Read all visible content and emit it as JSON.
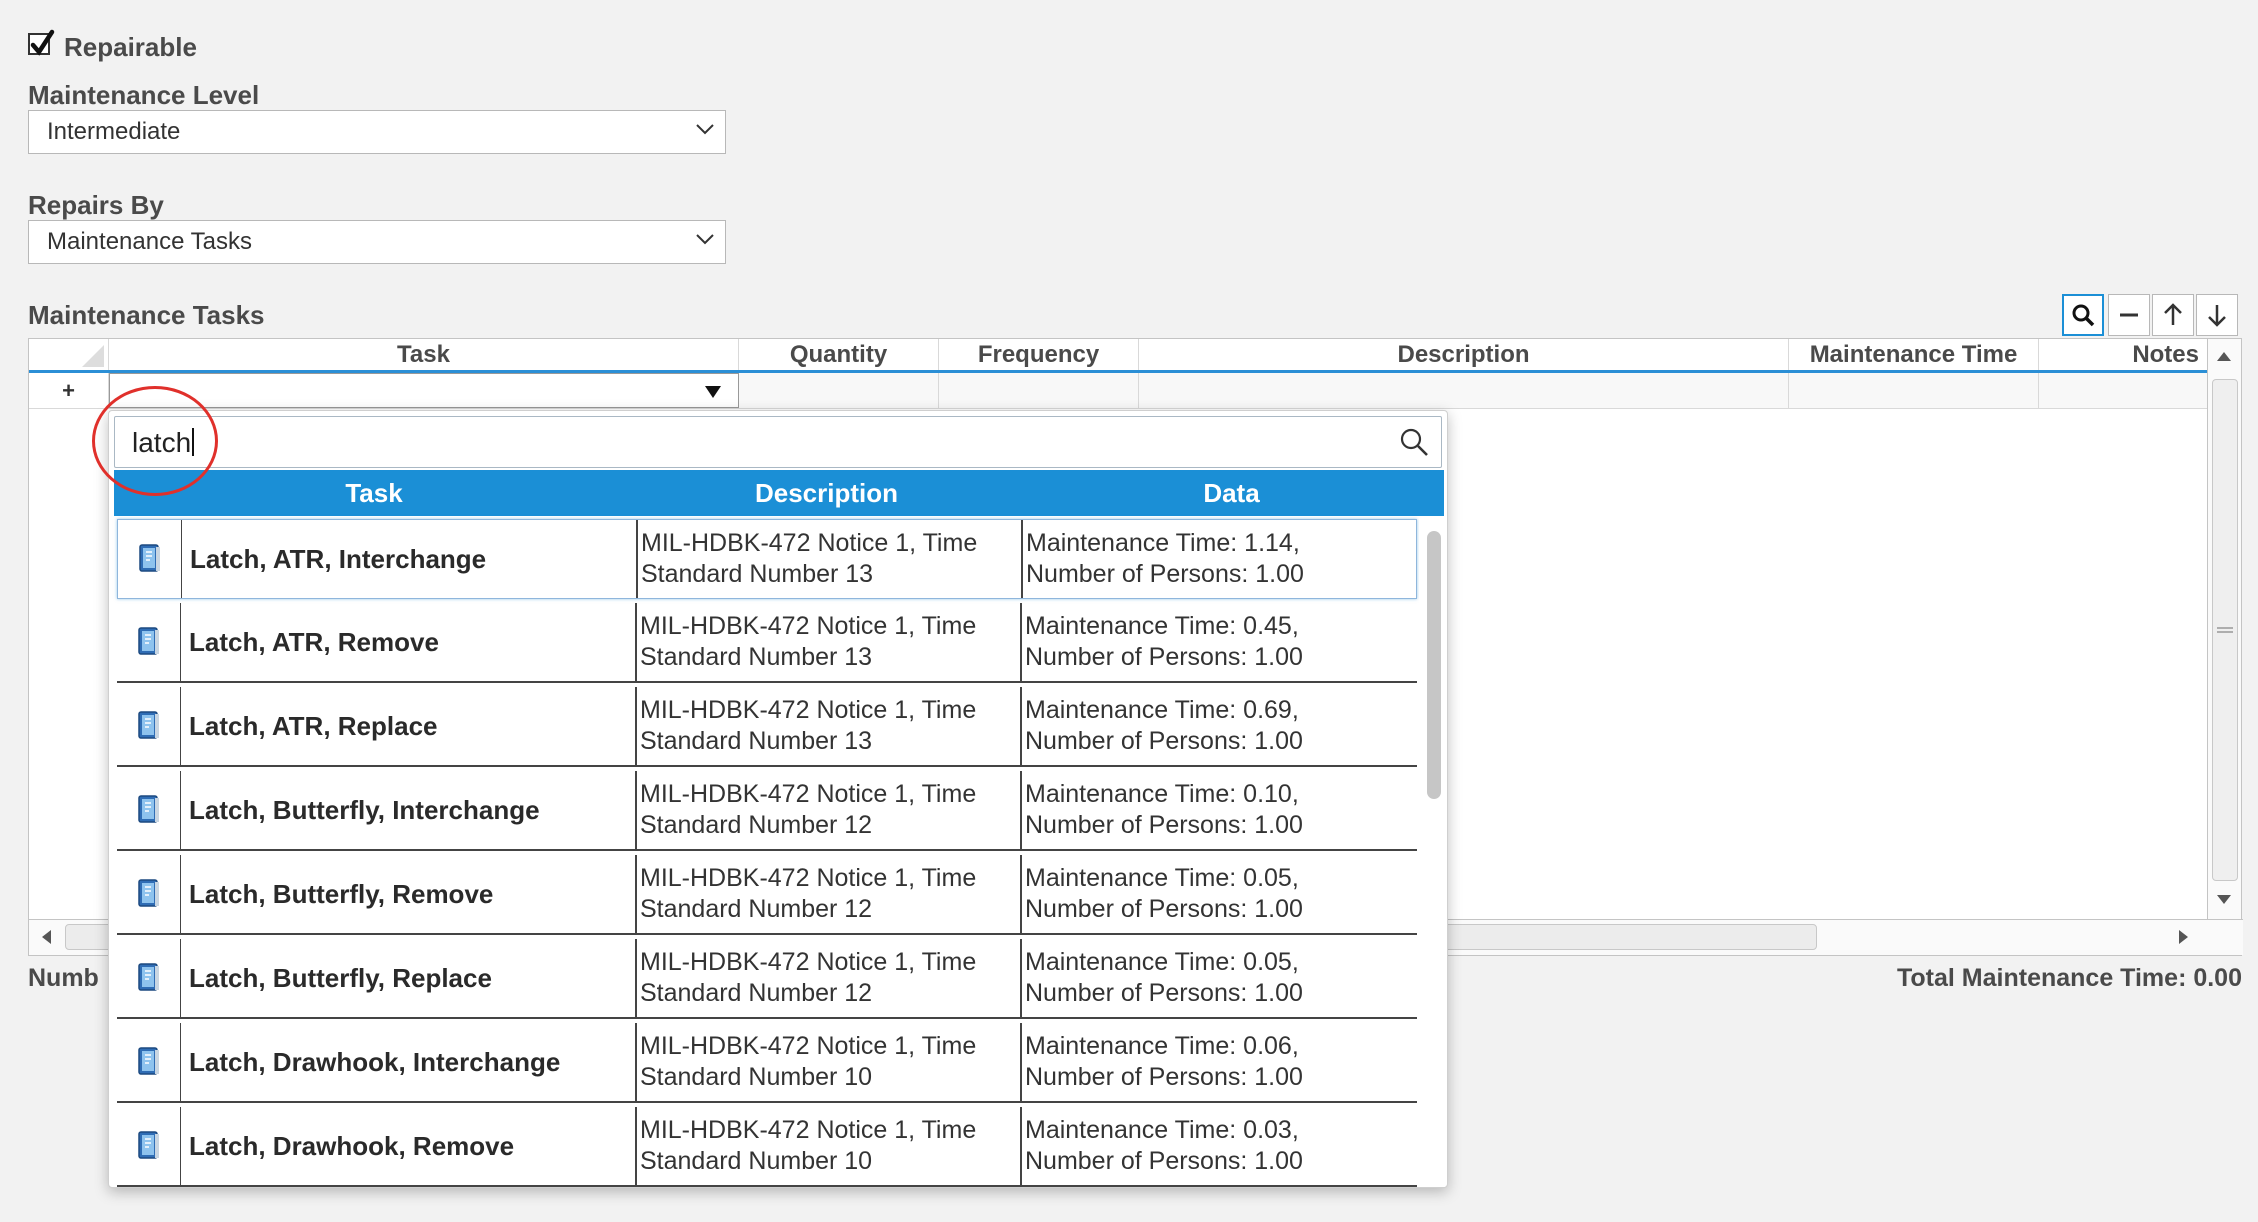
{
  "repairable": {
    "label": "Repairable",
    "checked": true
  },
  "maintenance_level": {
    "label": "Maintenance Level",
    "value": "Intermediate"
  },
  "repairs_by": {
    "label": "Repairs By",
    "value": "Maintenance Tasks"
  },
  "tasks_section": {
    "title": "Maintenance Tasks"
  },
  "toolbar": {
    "search_icon": "search-icon",
    "remove_icon": "minus-icon",
    "up_icon": "arrow-up-icon",
    "down_icon": "arrow-down-icon"
  },
  "grid": {
    "columns": [
      "Task",
      "Quantity",
      "Frequency",
      "Description",
      "Maintenance Time",
      "Notes"
    ],
    "add_row_symbol": "+"
  },
  "footer": {
    "left": "Numb",
    "right": "Total Maintenance Time: 0.00"
  },
  "popup": {
    "search_value": "latch",
    "columns": [
      "Task",
      "Description",
      "Data"
    ],
    "rows": [
      {
        "task": "Latch, ATR, Interchange",
        "desc1": "MIL-HDBK-472 Notice 1, Time",
        "desc2": "Standard Number 13",
        "data1": "Maintenance Time: 1.14,",
        "data2": "Number of Persons: 1.00"
      },
      {
        "task": "Latch, ATR, Remove",
        "desc1": "MIL-HDBK-472 Notice 1, Time",
        "desc2": "Standard Number 13",
        "data1": "Maintenance Time: 0.45,",
        "data2": "Number of Persons: 1.00"
      },
      {
        "task": "Latch, ATR, Replace",
        "desc1": "MIL-HDBK-472 Notice 1, Time",
        "desc2": "Standard Number 13",
        "data1": "Maintenance Time: 0.69,",
        "data2": "Number of Persons: 1.00"
      },
      {
        "task": "Latch, Butterfly, Interchange",
        "desc1": "MIL-HDBK-472 Notice 1, Time",
        "desc2": "Standard Number 12",
        "data1": "Maintenance Time: 0.10,",
        "data2": "Number of Persons: 1.00"
      },
      {
        "task": "Latch, Butterfly, Remove",
        "desc1": "MIL-HDBK-472 Notice 1, Time",
        "desc2": "Standard Number 12",
        "data1": "Maintenance Time: 0.05,",
        "data2": "Number of Persons: 1.00"
      },
      {
        "task": "Latch, Butterfly, Replace",
        "desc1": "MIL-HDBK-472 Notice 1, Time",
        "desc2": "Standard Number 12",
        "data1": "Maintenance Time: 0.05,",
        "data2": "Number of Persons: 1.00"
      },
      {
        "task": "Latch, Drawhook, Interchange",
        "desc1": "MIL-HDBK-472 Notice 1, Time",
        "desc2": "Standard Number 10",
        "data1": "Maintenance Time: 0.06,",
        "data2": "Number of Persons: 1.00"
      },
      {
        "task": "Latch, Drawhook, Remove",
        "desc1": "MIL-HDBK-472 Notice 1, Time",
        "desc2": "Standard Number 10",
        "data1": "Maintenance Time: 0.03,",
        "data2": "Number of Persons: 1.00"
      }
    ]
  },
  "colors": {
    "accent": "#1b8fd6",
    "highlight_circle": "#e0302b"
  }
}
